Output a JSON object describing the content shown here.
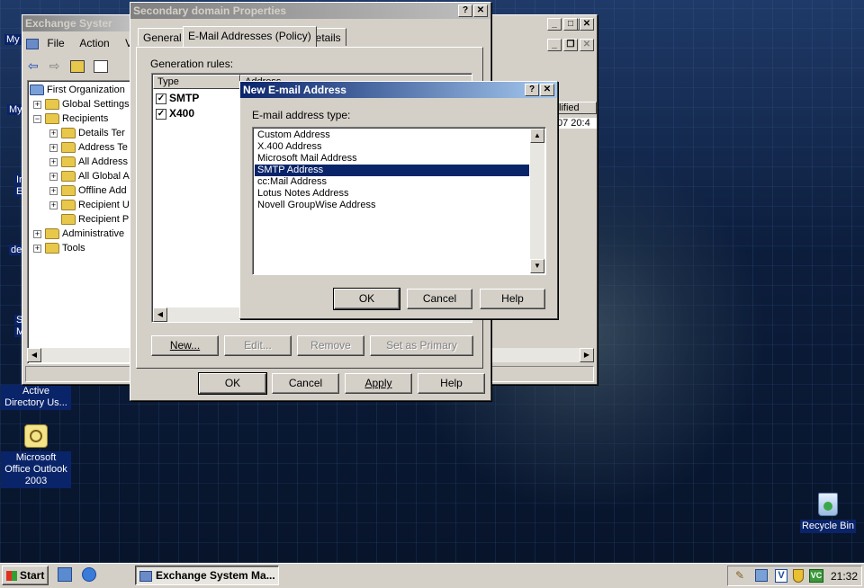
{
  "desktop": {
    "icons": [
      {
        "label": "Active Directory Us..."
      },
      {
        "label": "Microsoft Office Outlook 2003"
      },
      {
        "label": "Recycle Bin"
      }
    ],
    "edge_labels": [
      "My",
      "My",
      "In",
      "E",
      "de",
      "S",
      "M"
    ]
  },
  "esm": {
    "title": "Exchange Syster",
    "menu": [
      "File",
      "Action",
      "Vie"
    ],
    "tree": [
      {
        "label": "First Organization",
        "level": 0
      },
      {
        "label": "Global Settings",
        "level": 1
      },
      {
        "label": "Recipients",
        "level": 1
      },
      {
        "label": "Details Ter",
        "level": 2
      },
      {
        "label": "Address Te",
        "level": 2
      },
      {
        "label": "All Address",
        "level": 2
      },
      {
        "label": "All Global A",
        "level": 2
      },
      {
        "label": "Offline Add",
        "level": 2
      },
      {
        "label": "Recipient U",
        "level": 2
      },
      {
        "label": "Recipient P",
        "level": 2
      },
      {
        "label": "Administrative",
        "level": 1
      },
      {
        "label": "Tools",
        "level": 1
      }
    ],
    "right_header": "lified",
    "right_value": "07 20:4"
  },
  "props": {
    "title": "Secondary domain Properties",
    "tabs": [
      "General",
      "E-Mail Addresses (Policy)",
      "Details"
    ],
    "generation_rules_label": "Generation rules:",
    "columns": [
      "Type",
      "Address"
    ],
    "rows": [
      {
        "type": "SMTP",
        "checked": true
      },
      {
        "type": "X400",
        "checked": true
      }
    ],
    "buttons": {
      "new": "New...",
      "edit": "Edit...",
      "remove": "Remove",
      "set_primary": "Set as Primary"
    },
    "footer": {
      "ok": "OK",
      "cancel": "Cancel",
      "apply": "Apply",
      "help": "Help"
    }
  },
  "newaddr": {
    "title": "New E-mail Address",
    "type_label": "E-mail address type:",
    "options": [
      "Custom Address",
      "X.400 Address",
      "Microsoft Mail Address",
      "SMTP Address",
      "cc:Mail Address",
      "Lotus Notes Address",
      "Novell GroupWise Address"
    ],
    "selected": "SMTP Address",
    "ok": "OK",
    "cancel": "Cancel",
    "help": "Help"
  },
  "taskbar": {
    "start": "Start",
    "task": "Exchange System Ma...",
    "clock": "21:32"
  },
  "colors": {
    "title_active": "#0a246a",
    "selection": "#0a246a",
    "face": "#d4d0c8"
  }
}
